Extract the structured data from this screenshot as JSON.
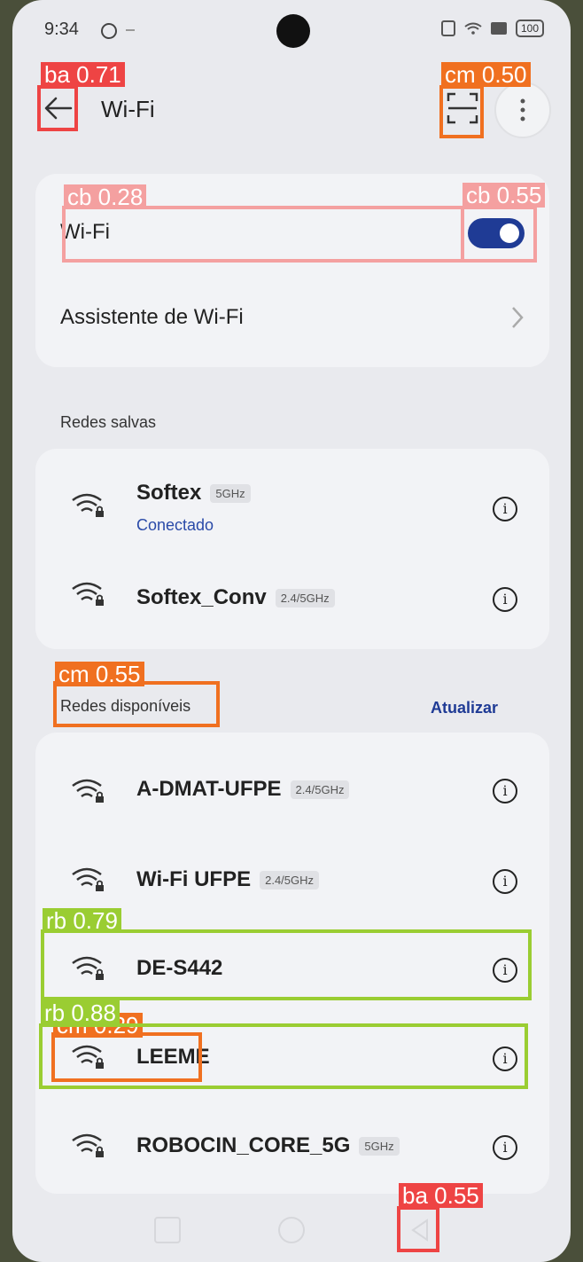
{
  "status": {
    "time": "9:34",
    "battery": "100"
  },
  "header": {
    "title": "Wi-Fi"
  },
  "toggle_card": {
    "wifi_label": "Wi-Fi",
    "assistant_label": "Assistente de Wi-Fi"
  },
  "saved": {
    "section_label": "Redes salvas",
    "networks": [
      {
        "ssid": "Softex",
        "band": "5GHz",
        "status": "Conectado"
      },
      {
        "ssid": "Softex_Conv",
        "band": "2.4/5GHz"
      }
    ]
  },
  "available": {
    "section_label": "Redes disponíveis",
    "refresh_label": "Atualizar",
    "networks": [
      {
        "ssid": "A-DMAT-UFPE",
        "band": "2.4/5GHz"
      },
      {
        "ssid": "Wi-Fi UFPE",
        "band": "2.4/5GHz"
      },
      {
        "ssid": "DE-S442",
        "band": ""
      },
      {
        "ssid": "LEEME",
        "band": ""
      },
      {
        "ssid": "ROBOCIN_CORE_5G",
        "band": "5GHz"
      }
    ]
  },
  "info_glyph": "i",
  "detections": [
    {
      "label": "ba 0.71",
      "color": "#ee4444"
    },
    {
      "label": "cm 0.50",
      "color": "#f07020"
    },
    {
      "label": "cb 0.28",
      "color": "#f4a0a0"
    },
    {
      "label": "cb 0.55",
      "color": "#f4a0a0"
    },
    {
      "label": "cm 0.55",
      "color": "#f07020"
    },
    {
      "label": "rb 0.79",
      "color": "#9acd32"
    },
    {
      "label": "cm 0.29",
      "color": "#f07020"
    },
    {
      "label": "rb 0.88",
      "color": "#9acd32"
    },
    {
      "label": "ba 0.55",
      "color": "#ee4444"
    }
  ]
}
